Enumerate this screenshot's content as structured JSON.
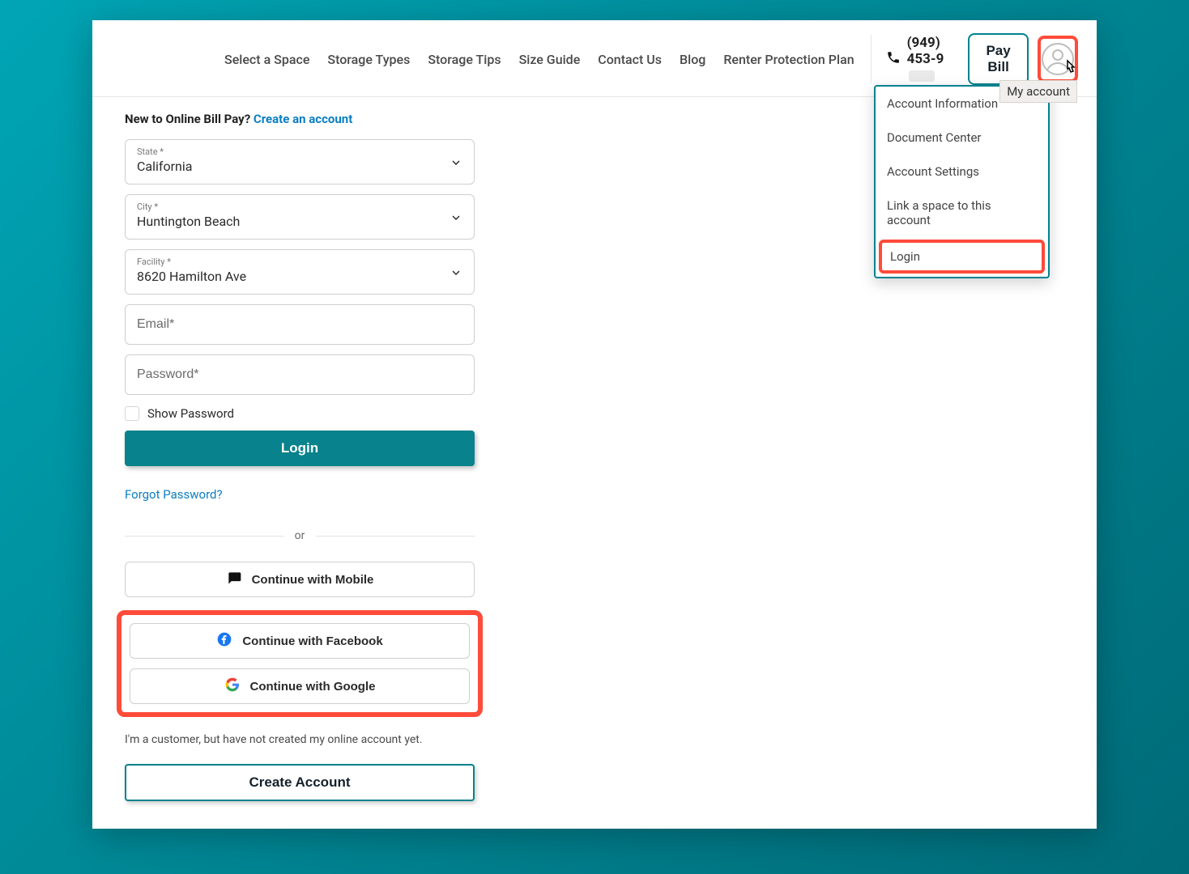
{
  "nav": {
    "links": [
      "Select a Space",
      "Storage Types",
      "Storage Tips",
      "Size Guide",
      "Contact Us",
      "Blog",
      "Renter Protection Plan"
    ],
    "phone": "(949) 453-9",
    "pay_bill": "Pay Bill",
    "tooltip": "My account"
  },
  "menu": {
    "items": [
      "Account Information",
      "Document Center",
      "Account Settings",
      "Link a space to this account"
    ],
    "login": "Login"
  },
  "form": {
    "heading_prefix": "New to Online Bill Pay? ",
    "heading_link": "Create an account",
    "state_label": "State *",
    "state_value": "California",
    "city_label": "City *",
    "city_value": "Huntington Beach",
    "facility_label": "Facility *",
    "facility_value": "8620 Hamilton Ave",
    "email_placeholder": "Email*",
    "password_placeholder": "Password*",
    "show_password": "Show Password",
    "login_btn": "Login",
    "forgot": "Forgot Password?",
    "or": "or",
    "mobile": "Continue with Mobile",
    "facebook": "Continue with Facebook",
    "google": "Continue with Google",
    "note": "I'm a customer, but have not created my online account yet.",
    "create": "Create Account"
  },
  "colors": {
    "teal": "#08828c",
    "highlight": "#ff4b3a",
    "link": "#0a7ec2"
  }
}
